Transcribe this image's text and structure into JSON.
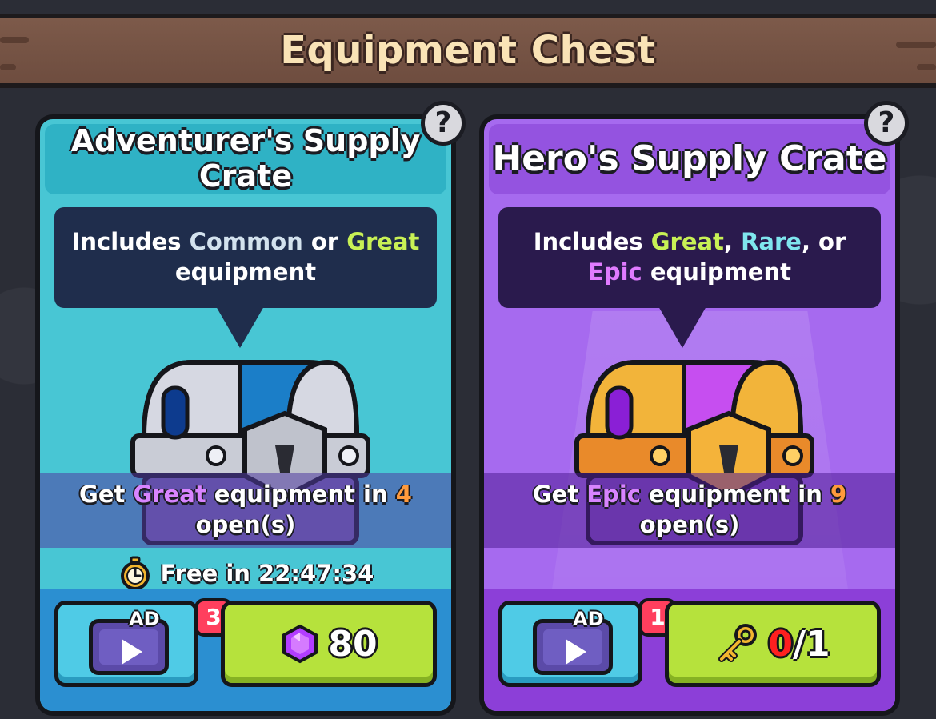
{
  "header": {
    "title": "Equipment Chest"
  },
  "crates": [
    {
      "title_line1": "Adventurer's Supply",
      "title_line2": "Crate",
      "help": "?",
      "desc": {
        "prefix": "Includes ",
        "t1": "Common",
        "mid": " or ",
        "t2": "Great",
        "suffix": " equipment"
      },
      "progress": {
        "prefix": "Get ",
        "tier": "Great",
        "mid": " equipment in ",
        "count": "4",
        "suffix": "open(s)"
      },
      "timer": "Free in 22:47:34",
      "ad": {
        "label": "AD",
        "badge": "3"
      },
      "price": {
        "icon": "gem-icon",
        "value": "80"
      }
    },
    {
      "title_line1": "Hero's Supply Crate",
      "help": "?",
      "desc": {
        "prefix": "Includes ",
        "t1": "Great",
        "sep1": ", ",
        "t2": "Rare",
        "sep2": ", or",
        "t3": "Epic",
        "suffix": " equipment"
      },
      "progress": {
        "prefix": "Get ",
        "tier": "Epic",
        "mid": " equipment in ",
        "count": "9",
        "suffix": "open(s)"
      },
      "ad": {
        "label": "AD",
        "badge": "1"
      },
      "price": {
        "icon": "key-icon",
        "owned": "0",
        "required": "/1"
      }
    }
  ]
}
